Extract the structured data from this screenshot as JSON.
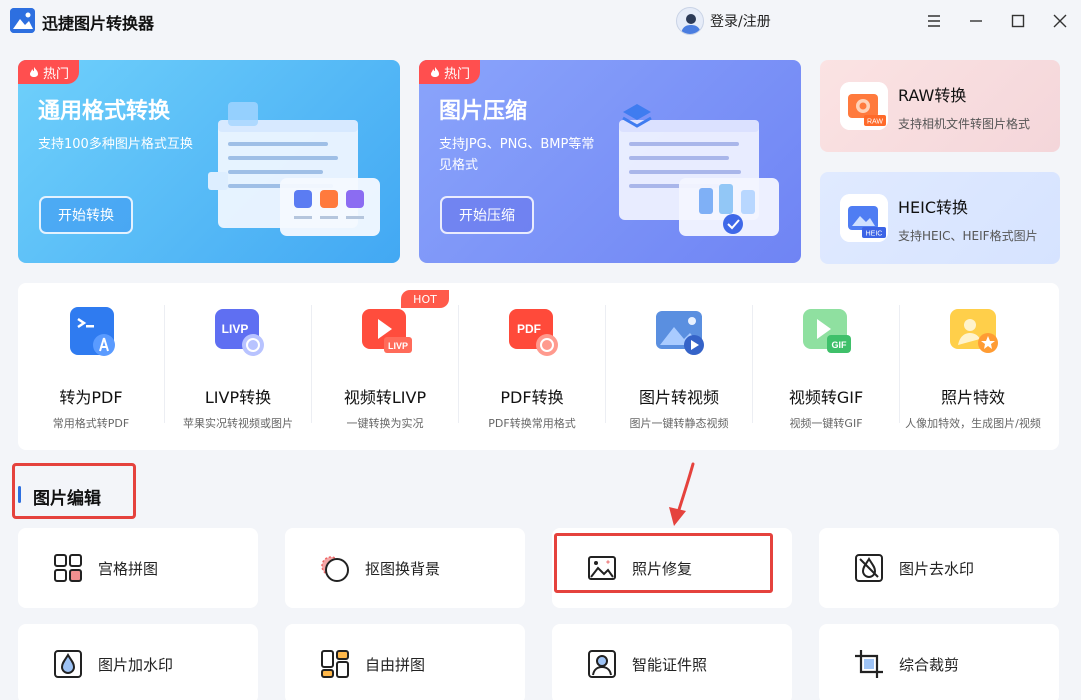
{
  "app": {
    "title": "迅捷图片转换器",
    "login": "登录/注册"
  },
  "banners": [
    {
      "tag": "热门",
      "title": "通用格式转换",
      "desc": "支持100多种图片格式互换",
      "button": "开始转换"
    },
    {
      "tag": "热门",
      "title": "图片压缩",
      "desc": "支持JPG、PNG、BMP等常见格式",
      "button": "开始压缩"
    }
  ],
  "side_cards": [
    {
      "title": "RAW转换",
      "desc": "支持相机文件转图片格式",
      "icon": "raw-icon",
      "badge": "RAW"
    },
    {
      "title": "HEIC转换",
      "desc": "支持HEIC、HEIF格式图片",
      "icon": "heic-icon",
      "badge": "HEIC"
    }
  ],
  "tools": [
    {
      "name": "转为PDF",
      "desc": "常用格式转PDF",
      "icon": "pdf-convert-icon"
    },
    {
      "name": "LIVP转换",
      "desc": "苹果实况转视频或图片",
      "icon": "livp-icon",
      "label": "LIVP"
    },
    {
      "name": "视频转LIVP",
      "desc": "一键转换为实况",
      "icon": "video-livp-icon",
      "badge": "HOT",
      "label": "LIVP"
    },
    {
      "name": "PDF转换",
      "desc": "PDF转换常用格式",
      "icon": "pdf-icon",
      "label": "PDF"
    },
    {
      "name": "图片转视频",
      "desc": "图片一键转静态视频",
      "icon": "image-video-icon"
    },
    {
      "name": "视频转GIF",
      "desc": "视频一键转GIF",
      "icon": "gif-icon",
      "label": "GIF"
    },
    {
      "name": "照片特效",
      "desc": "人像加特效，生成图片/视频",
      "icon": "effect-icon"
    }
  ],
  "section": {
    "title": "图片编辑"
  },
  "edit_cards": [
    {
      "label": "宫格拼图",
      "icon": "grid-icon"
    },
    {
      "label": "抠图换背景",
      "icon": "cutout-icon"
    },
    {
      "label": "照片修复",
      "icon": "repair-icon"
    },
    {
      "label": "图片去水印",
      "icon": "remove-watermark-icon"
    },
    {
      "label": "图片加水印",
      "icon": "watermark-icon"
    },
    {
      "label": "自由拼图",
      "icon": "collage-icon"
    },
    {
      "label": "智能证件照",
      "icon": "id-photo-icon"
    },
    {
      "label": "综合裁剪",
      "icon": "crop-icon"
    }
  ],
  "colors": {
    "accent": "#2d6fe0",
    "highlight": "#e5423d",
    "hot": "#ff4f4f"
  }
}
